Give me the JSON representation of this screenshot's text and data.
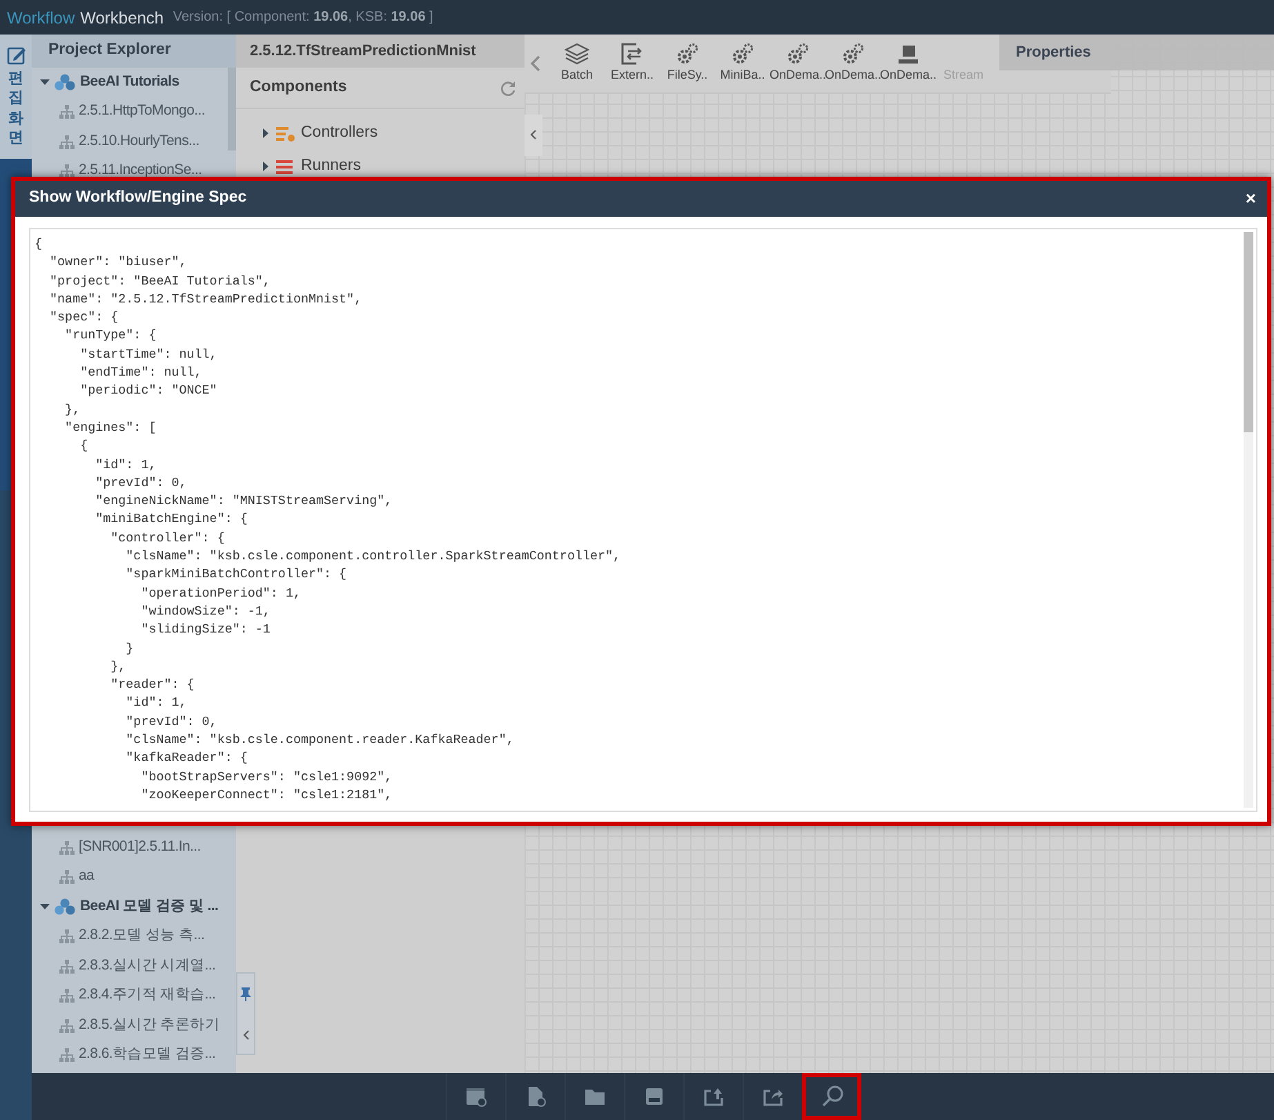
{
  "app_header": {
    "brand_first": "Workflow",
    "brand_second": "Workbench",
    "version": "Version: [ Component: **19.06**, KSB: **19.06** ]"
  },
  "side_rail": {
    "items": [
      {
        "label": "편집화면",
        "selected": true
      }
    ]
  },
  "project_explorer": {
    "title": "Project Explorer",
    "tree": [
      {
        "kind": "group",
        "label": "BeeAI Tutorials",
        "expanded": true,
        "children": [
          {
            "kind": "project",
            "label": "2.5.1.HttpToMongo..."
          },
          {
            "kind": "project",
            "label": "2.5.10.HourlyTens..."
          },
          {
            "kind": "project",
            "label": "2.5.11.InceptionSe..."
          }
        ]
      }
    ],
    "tree_continued": [
      {
        "kind": "project",
        "label": "[SNR001]2.5.11.In..."
      },
      {
        "kind": "project",
        "label": "aa"
      },
      {
        "kind": "group",
        "label": "BeeAI 모델 검증 및 ...",
        "expanded": true,
        "children": [
          {
            "kind": "project",
            "label": "2.8.2.모델 성능 측..."
          },
          {
            "kind": "project",
            "label": "2.8.3.실시간 시계열..."
          },
          {
            "kind": "project",
            "label": "2.8.4.주기적 재학습..."
          },
          {
            "kind": "project",
            "label": "2.8.5.실시간 추론하기"
          },
          {
            "kind": "project",
            "label": "2.8.6.학습모델 검증..."
          }
        ]
      }
    ]
  },
  "workflow_tab": {
    "title": "2.5.12.TfStreamPredictionMnist"
  },
  "components": {
    "title": "Components",
    "items": [
      {
        "kind": "controllers",
        "label": "Controllers",
        "expanded": false
      },
      {
        "kind": "runners",
        "label": "Runners",
        "expanded": false
      }
    ]
  },
  "toolbar": {
    "items": [
      {
        "kind": "layers",
        "label": "Batch",
        "disabled": false
      },
      {
        "kind": "exchange",
        "label": "Extern..",
        "disabled": false
      },
      {
        "kind": "gear",
        "label": "FileSy..",
        "disabled": false
      },
      {
        "kind": "gear",
        "label": "MiniBa..",
        "disabled": false
      },
      {
        "kind": "gear",
        "label": "OnDema..",
        "disabled": false
      },
      {
        "kind": "gear",
        "label": "OnDema..",
        "disabled": false
      },
      {
        "kind": "chip",
        "label": "OnDema..",
        "disabled": false
      },
      {
        "kind": "none",
        "label": "Stream",
        "disabled": true
      }
    ]
  },
  "properties": {
    "title": "Properties"
  },
  "modal": {
    "title": "Show Workflow/Engine Spec",
    "close": "×",
    "spec_lines": [
      "{",
      "  \"owner\": \"biuser\",",
      "  \"project\": \"BeeAI Tutorials\",",
      "  \"name\": \"2.5.12.TfStreamPredictionMnist\",",
      "  \"spec\": {",
      "    \"runType\": {",
      "      \"startTime\": null,",
      "      \"endTime\": null,",
      "      \"periodic\": \"ONCE\"",
      "    },",
      "    \"engines\": [",
      "      {",
      "        \"id\": 1,",
      "        \"prevId\": 0,",
      "        \"engineNickName\": \"MNISTStreamServing\",",
      "        \"miniBatchEngine\": {",
      "          \"controller\": {",
      "            \"clsName\": \"ksb.csle.component.controller.SparkStreamController\",",
      "            \"sparkMiniBatchController\": {",
      "              \"operationPeriod\": 1,",
      "              \"windowSize\": -1,",
      "              \"slidingSize\": -1",
      "            }",
      "          },",
      "          \"reader\": {",
      "            \"id\": 1,",
      "            \"prevId\": 0,",
      "            \"clsName\": \"ksb.csle.component.reader.KafkaReader\",",
      "            \"kafkaReader\": {",
      "              \"bootStrapServers\": \"csle1:9092\",",
      "              \"zooKeeperConnect\": \"csle1:2181\","
    ]
  },
  "bottom_toolbar": {
    "buttons": [
      {
        "kind": "new-window",
        "selected": false
      },
      {
        "kind": "new-file",
        "selected": false
      },
      {
        "kind": "folder",
        "selected": false
      },
      {
        "kind": "save",
        "selected": false
      },
      {
        "kind": "import",
        "selected": false
      },
      {
        "kind": "export",
        "selected": false
      },
      {
        "kind": "search",
        "selected": true
      }
    ]
  }
}
